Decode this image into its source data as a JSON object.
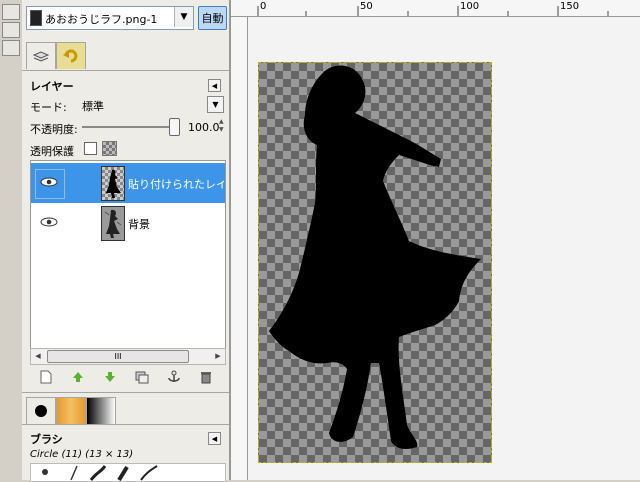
{
  "image_menu": {
    "name": "あおおうじラフ.png-1",
    "auto_label": "自動"
  },
  "layers_panel": {
    "title": "レイヤー",
    "mode_label": "モード:",
    "mode_value": "標準",
    "opacity_label": "不透明度:",
    "opacity_value": "100.0",
    "opacity_fraction": 1.0,
    "lock_label": "透明保護",
    "layers": [
      {
        "name": "貼り付けられたレイヤー",
        "visible": true,
        "selected": true
      },
      {
        "name": "背景",
        "visible": true,
        "selected": false
      }
    ],
    "scrollbar_grip": "III"
  },
  "brush_panel": {
    "title": "ブラシ",
    "brush_name": "Circle (11) (13 × 13)"
  },
  "ruler": {
    "ticks": [
      "0",
      "50",
      "100",
      "150"
    ]
  },
  "colors": {
    "selection": "#3c95e8",
    "canvas_bg": "#f3f3f3",
    "accent": "#bcd8f6"
  },
  "icons": [
    "layers-tab-icon",
    "undo-history-tab-icon",
    "eye-icon",
    "new-layer-icon",
    "raise-layer-icon",
    "lower-layer-icon",
    "duplicate-layer-icon",
    "anchor-icon",
    "delete-layer-icon",
    "brush-icon",
    "pattern-icon",
    "gradient-icon"
  ]
}
